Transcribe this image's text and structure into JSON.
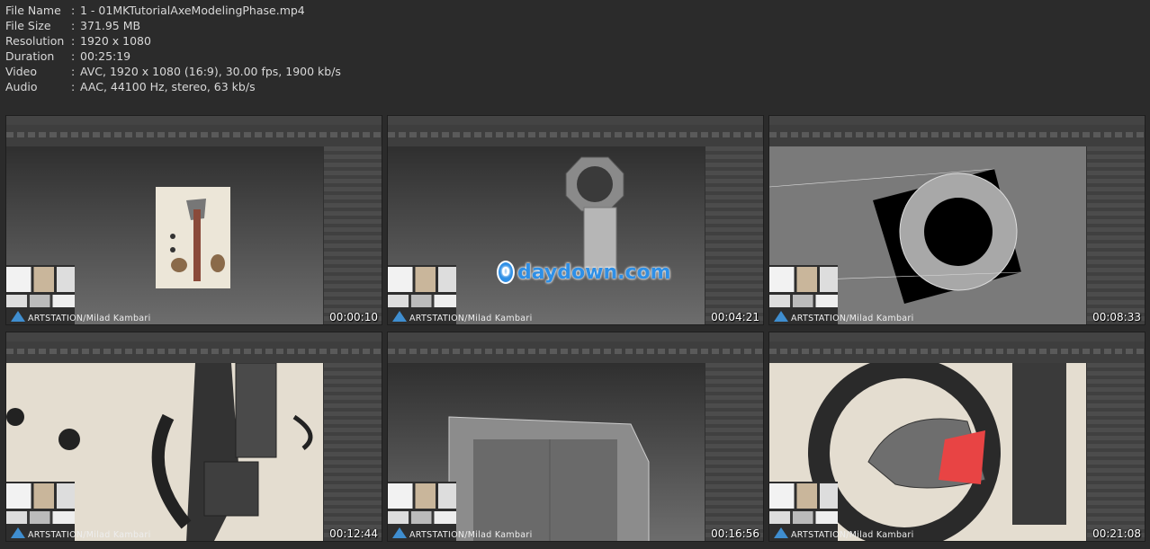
{
  "file_info": [
    {
      "key": "File Name",
      "value": "1 - 01MKTutorialAxeModelingPhase.mp4"
    },
    {
      "key": "File Size",
      "value": "371.95 MB"
    },
    {
      "key": "Resolution",
      "value": "1920 x 1080"
    },
    {
      "key": "Duration",
      "value": "00:25:19"
    },
    {
      "key": "Video",
      "value": "AVC, 1920 x 1080 (16:9), 30.00 fps, 1900 kb/s"
    },
    {
      "key": "Audio",
      "value": "AAC, 44100 Hz, stereo, 63 kb/s"
    }
  ],
  "separator": ":",
  "caption": "ARTSTATION/Milad Kambari",
  "watermark": {
    "icon": "0",
    "text": "daydown.com"
  },
  "thumbnails": [
    {
      "timestamp": "00:00:10",
      "scene": "reference-sheet"
    },
    {
      "timestamp": "00:04:21",
      "scene": "ring-and-box"
    },
    {
      "timestamp": "00:08:33",
      "scene": "ring-wireframe"
    },
    {
      "timestamp": "00:12:44",
      "scene": "axe-closeup"
    },
    {
      "timestamp": "00:16:56",
      "scene": "box-closeup"
    },
    {
      "timestamp": "00:21:08",
      "scene": "hook-red-face"
    }
  ],
  "colors": {
    "background": "#2b2b2b",
    "accent": "#3f8ed0",
    "watermark": "#2e8fe6"
  }
}
